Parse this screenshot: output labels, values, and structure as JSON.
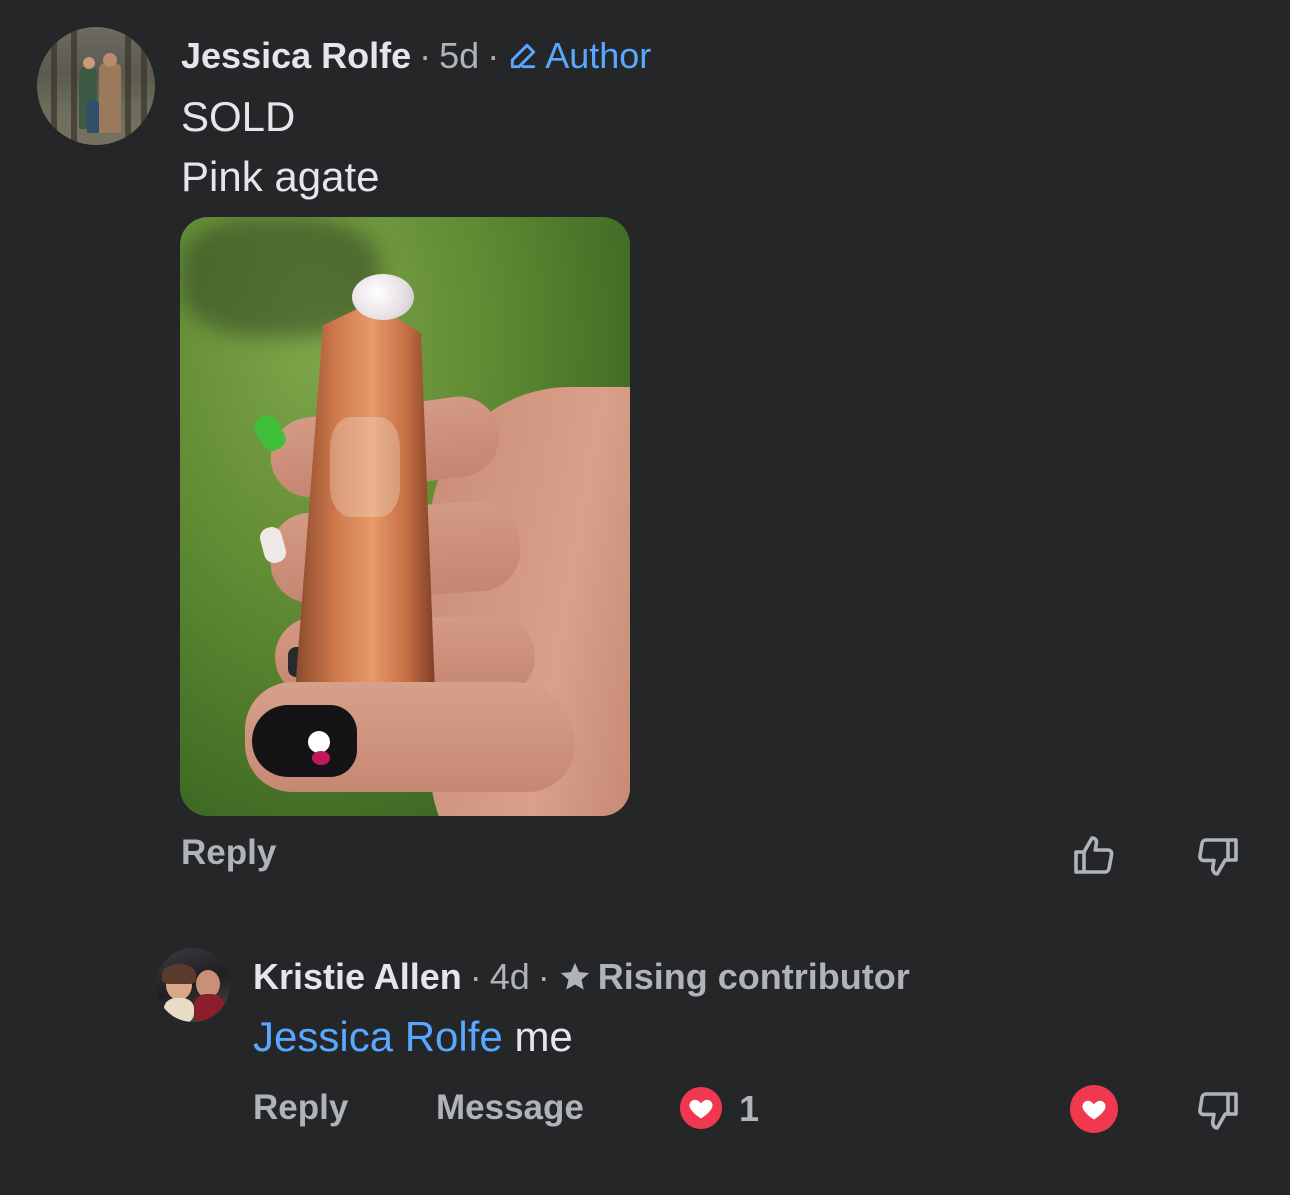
{
  "comment": {
    "author": "Jessica Rolfe",
    "time": "5d",
    "badge": "Author",
    "lines": [
      "SOLD",
      "Pink agate"
    ],
    "actions": {
      "reply": "Reply"
    },
    "icons": {
      "badge_icon": "pencil-icon",
      "upvote_icon": "thumbs-up-icon",
      "downvote_icon": "thumbs-down-icon"
    }
  },
  "reply": {
    "author": "Kristie Allen",
    "time": "4d",
    "badge": "Rising contributor",
    "mention": "Jessica Rolfe",
    "text": "me",
    "actions": {
      "reply": "Reply",
      "message": "Message"
    },
    "reaction_count": "1",
    "icons": {
      "badge_icon": "star-icon",
      "reaction_icon": "heart-icon",
      "like_icon": "heart-icon",
      "downvote_icon": "thumbs-down-icon"
    }
  },
  "colors": {
    "background": "#252628",
    "link_blue": "#5aa7ff",
    "muted": "#b0b3b8",
    "heart_red": "#f0394f"
  }
}
